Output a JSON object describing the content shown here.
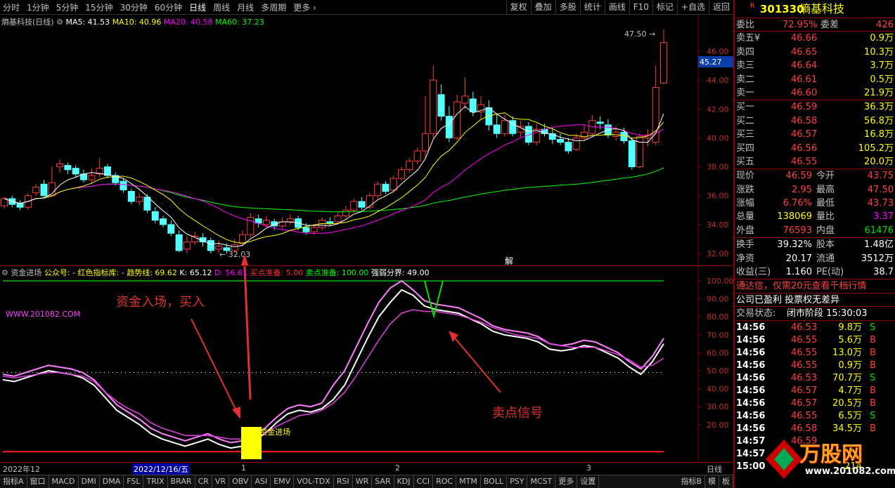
{
  "toolbar": {
    "timeframes": [
      "分时",
      "1分钟",
      "5分钟",
      "15分钟",
      "30分钟",
      "60分钟",
      "日线",
      "周线",
      "月线",
      "多周期",
      "更多"
    ],
    "active": "日线",
    "right_buttons": [
      "复权",
      "叠加",
      "多股",
      "统计",
      "画线",
      "F10",
      "标记",
      "+自选",
      "返回"
    ]
  },
  "main": {
    "title": "熵基科技(日线)",
    "ma": [
      {
        "label": "MA5: 41.53",
        "color": "#ffffff"
      },
      {
        "label": "MA10: 40.96",
        "color": "#ffff00"
      },
      {
        "label": "MA20: 40.58",
        "color": "#ff00ff"
      },
      {
        "label": "MA60: 37.23",
        "color": "#00ff00"
      }
    ],
    "price_ticks": [
      "46.00",
      "44.00",
      "42.00",
      "40.00",
      "38.00",
      "36.00",
      "34.00",
      "32.00"
    ],
    "price_current": "45.27",
    "high_label": "47.50",
    "low_label": "32.03",
    "marker": "解"
  },
  "indicator": {
    "name": "资金进场",
    "items": [
      {
        "label": "公众号: -",
        "color": "#ffff00"
      },
      {
        "label": "红色指标库: -",
        "color": "#ffff00"
      },
      {
        "label": "趋势线: 69.62",
        "color": "#ffff00"
      },
      {
        "label": "K: 65.12",
        "color": "#ffffff"
      },
      {
        "label": "D: 56.61",
        "color": "#ff00ff"
      },
      {
        "label": "买点准备: 5.00",
        "color": "#ff3030"
      },
      {
        "label": "卖点准备: 100.00",
        "color": "#00ff00"
      },
      {
        "label": "强弱分界: 49.00",
        "color": "#ffffff"
      }
    ],
    "ticks": [
      "100.00",
      "90.00",
      "80.00",
      "70.00",
      "60.00",
      "50.00",
      "40.00",
      "30.00",
      "20.00"
    ],
    "watermark": "WWW.201082.COM",
    "annotation_buy": "资金入场，买入",
    "annotation_sell": "卖点信号",
    "signal_label": "资金进场"
  },
  "dates": {
    "d1": "2022年12",
    "d2": "2022/12/16/五",
    "d3": "1",
    "d4": "2",
    "d5": "3",
    "period": "日线"
  },
  "bottombar": [
    "指标A",
    "窗口",
    "MACD",
    "DMI",
    "DMA",
    "FSL",
    "TRIX",
    "BRAR",
    "CR",
    "VR",
    "OBV",
    "ASI",
    "EMV",
    "VOL-TDX",
    "RSI",
    "WR",
    "SAR",
    "KDJ",
    "CCI",
    "ROC",
    "MTM",
    "BOLL",
    "PSY",
    "MCST",
    "更多",
    "设置"
  ],
  "bottom_right": [
    "指标B",
    "模",
    "板"
  ],
  "quote": {
    "badge": "R",
    "code": "301330",
    "name": "熵基科技",
    "webi": {
      "l1": "委比",
      "v1": "72.95%",
      "l2": "委差",
      "v2": "426"
    },
    "asks": [
      {
        "label": "卖五",
        "flag": "¥",
        "price": "46.66",
        "vol": "0.9万"
      },
      {
        "label": "卖四",
        "flag": "",
        "price": "46.65",
        "vol": "10.3万"
      },
      {
        "label": "卖三",
        "flag": "",
        "price": "46.64",
        "vol": "3.7万"
      },
      {
        "label": "卖二",
        "flag": "",
        "price": "46.61",
        "vol": "0.5万"
      },
      {
        "label": "卖一",
        "flag": "",
        "price": "46.60",
        "vol": "21.9万"
      }
    ],
    "bids": [
      {
        "label": "买一",
        "price": "46.59",
        "vol": "36.3万"
      },
      {
        "label": "买二",
        "price": "46.58",
        "vol": "56.8万"
      },
      {
        "label": "买三",
        "price": "46.57",
        "vol": "16.8万"
      },
      {
        "label": "买四",
        "price": "46.56",
        "vol": "105.2万"
      },
      {
        "label": "买五",
        "price": "46.55",
        "vol": "20.0万"
      }
    ],
    "stats": [
      {
        "l1": "现价",
        "v1": "46.59",
        "c1": "#ff4040",
        "l2": "今开",
        "v2": "43.75",
        "c2": "#ff4040"
      },
      {
        "l1": "涨跌",
        "v1": "2.95",
        "c1": "#ff4040",
        "l2": "最高",
        "v2": "47.50",
        "c2": "#ff4040"
      },
      {
        "l1": "涨幅",
        "v1": "6.76%",
        "c1": "#ff4040",
        "l2": "最低",
        "v2": "43.73",
        "c2": "#ff4040"
      },
      {
        "l1": "总量",
        "v1": "138069",
        "c1": "#ffff00",
        "l2": "量比",
        "v2": "3.37",
        "c2": "#ff00ff"
      },
      {
        "l1": "外盘",
        "v1": "76593",
        "c1": "#ff4040",
        "l2": "内盘",
        "v2": "61476",
        "c2": "#00e000"
      }
    ],
    "stats2": [
      {
        "l1": "换手",
        "v1": "39.32%",
        "l2": "股本",
        "v2": "1.48亿"
      },
      {
        "l1": "净资",
        "v1": "20.17",
        "l2": "流通",
        "v2": "3512万"
      },
      {
        "l1": "收益(三)",
        "v1": "1.160",
        "l2": "PE(动)",
        "v2": "38.7"
      }
    ],
    "promo": "通达信，仅需20元查看千档行情",
    "news": "公司已盈利 投票权无差异",
    "status_label": "交易状态:",
    "status_value": "闭市阶段 15:30:03",
    "ticks": [
      {
        "t": "14:56",
        "p": "46.53",
        "v": "9.8万",
        "s": "S"
      },
      {
        "t": "14:56",
        "p": "46.55",
        "v": "5.6万",
        "s": "B"
      },
      {
        "t": "14:56",
        "p": "46.55",
        "v": "13.0万",
        "s": "B"
      },
      {
        "t": "14:56",
        "p": "46.55",
        "v": "0.9万",
        "s": "B"
      },
      {
        "t": "14:56",
        "p": "46.53",
        "v": "70.7万",
        "s": "S"
      },
      {
        "t": "14:56",
        "p": "46.57",
        "v": "4.7万",
        "s": "B"
      },
      {
        "t": "14:56",
        "p": "46.57",
        "v": "20.5万",
        "s": "B"
      },
      {
        "t": "14:56",
        "p": "46.55",
        "v": "6.5万",
        "s": "S"
      },
      {
        "t": "14:56",
        "p": "46.58",
        "v": "34.5万",
        "s": "B"
      },
      {
        "t": "14:57",
        "p": "46.59",
        "v": "",
        "s": ""
      },
      {
        "t": "14:57",
        "p": "",
        "v": "",
        "s": ""
      },
      {
        "t": "15:00",
        "p": "",
        "v": "214",
        "s": ""
      }
    ],
    "logo": "万股网",
    "logo_url": "www.201082.com"
  }
}
